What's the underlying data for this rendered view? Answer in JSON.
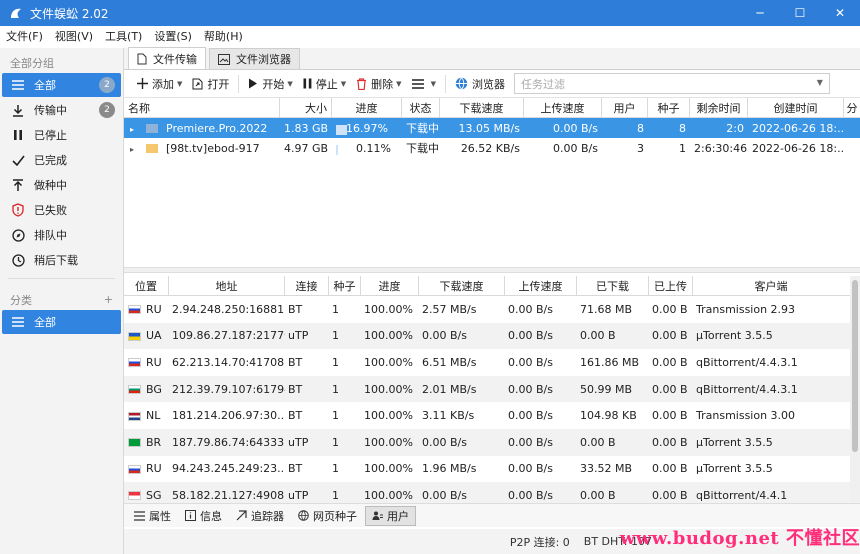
{
  "window": {
    "title": "文件蜈蚣 2.02",
    "minimize": "─",
    "maximize": "☐",
    "close": "✕"
  },
  "menu": [
    "文件(F)",
    "视图(V)",
    "工具(T)",
    "设置(S)",
    "帮助(H)"
  ],
  "sidebar": {
    "all_groups_label": "全部分组",
    "items": [
      {
        "label": "全部",
        "badge": "2",
        "icon": "list-icon"
      },
      {
        "label": "传输中",
        "badge": "2",
        "icon": "download-icon"
      },
      {
        "label": "已停止",
        "icon": "pause-icon"
      },
      {
        "label": "已完成",
        "icon": "check-icon"
      },
      {
        "label": "做种中",
        "icon": "seed-icon"
      },
      {
        "label": "已失败",
        "icon": "error-icon"
      },
      {
        "label": "排队中",
        "icon": "compass-icon"
      },
      {
        "label": "稍后下载",
        "icon": "clock-icon"
      }
    ],
    "category_label": "分类",
    "category_add": "+",
    "category_items": [
      {
        "label": "全部"
      }
    ]
  },
  "tabs": [
    {
      "label": "文件传输"
    },
    {
      "label": "文件浏览器"
    }
  ],
  "toolbar": {
    "add": "添加",
    "open": "打开",
    "start": "开始",
    "stop": "停止",
    "delete": "删除",
    "browser": "浏览器",
    "filter_placeholder": "任务过滤"
  },
  "tasks": {
    "columns": [
      "名称",
      "大小",
      "进度",
      "状态",
      "下载速度",
      "上传速度",
      "用户",
      "种子",
      "剩余时间",
      "创建时间",
      "分"
    ],
    "rows": [
      {
        "name": "Premiere.Pro.2022",
        "size": "1.83 GB",
        "progress": "16.97%",
        "progress_value": 0.1697,
        "status": "下载中",
        "down": "13.05 MB/s",
        "up": "0.00 B/s",
        "users": "8",
        "seeds": "8",
        "eta": "2:0",
        "created": "2022-06-26 18:...",
        "selected": true
      },
      {
        "name": "[98t.tv]ebod-917",
        "size": "4.97 GB",
        "progress": "0.11%",
        "progress_value": 0.0011,
        "status": "下载中",
        "down": "26.52 KB/s",
        "up": "0.00 B/s",
        "users": "3",
        "seeds": "1",
        "eta": "2:6:30:46",
        "created": "2022-06-26 18:...",
        "selected": false
      }
    ]
  },
  "peers": {
    "columns": [
      "位置",
      "地址",
      "连接",
      "种子",
      "进度",
      "下载速度",
      "上传速度",
      "已下载",
      "已上传",
      "客户端"
    ],
    "rows": [
      {
        "cc": "RU",
        "addr": "2.94.248.250:16881",
        "conn": "BT",
        "seed": "1",
        "prog": "100.00%",
        "down": "2.57 MB/s",
        "up": "0.00 B/s",
        "dl": "71.68 MB",
        "ul": "0.00 B",
        "client": "Transmission 2.93"
      },
      {
        "cc": "UA",
        "addr": "109.86.27.187:21770",
        "conn": "uTP",
        "seed": "1",
        "prog": "100.00%",
        "down": "0.00 B/s",
        "up": "0.00 B/s",
        "dl": "0.00 B",
        "ul": "0.00 B",
        "client": "µTorrent 3.5.5"
      },
      {
        "cc": "RU",
        "addr": "62.213.14.70:41708",
        "conn": "BT",
        "seed": "1",
        "prog": "100.00%",
        "down": "6.51 MB/s",
        "up": "0.00 B/s",
        "dl": "161.86 MB",
        "ul": "0.00 B",
        "client": "qBittorrent/4.4.3.1"
      },
      {
        "cc": "BG",
        "addr": "212.39.79.107:61794",
        "conn": "BT",
        "seed": "1",
        "prog": "100.00%",
        "down": "2.01 MB/s",
        "up": "0.00 B/s",
        "dl": "50.99 MB",
        "ul": "0.00 B",
        "client": "qBittorrent/4.4.3.1"
      },
      {
        "cc": "NL",
        "addr": "181.214.206.97:30...",
        "conn": "BT",
        "seed": "1",
        "prog": "100.00%",
        "down": "3.11 KB/s",
        "up": "0.00 B/s",
        "dl": "104.98 KB",
        "ul": "0.00 B",
        "client": "Transmission 3.00"
      },
      {
        "cc": "BR",
        "addr": "187.79.86.74:64333",
        "conn": "uTP",
        "seed": "1",
        "prog": "100.00%",
        "down": "0.00 B/s",
        "up": "0.00 B/s",
        "dl": "0.00 B",
        "ul": "0.00 B",
        "client": "µTorrent 3.5.5"
      },
      {
        "cc": "RU",
        "addr": "94.243.245.249:23...",
        "conn": "BT",
        "seed": "1",
        "prog": "100.00%",
        "down": "1.96 MB/s",
        "up": "0.00 B/s",
        "dl": "33.52 MB",
        "ul": "0.00 B",
        "client": "µTorrent 3.5.5"
      },
      {
        "cc": "SG",
        "addr": "58.182.21.127:49081",
        "conn": "uTP",
        "seed": "1",
        "prog": "100.00%",
        "down": "0.00 B/s",
        "up": "0.00 B/s",
        "dl": "0.00 B",
        "ul": "0.00 B",
        "client": "qBittorrent/4.4.1"
      }
    ]
  },
  "bottom_tabs": [
    {
      "label": "属性"
    },
    {
      "label": "信息"
    },
    {
      "label": "追踪器"
    },
    {
      "label": "网页种子"
    },
    {
      "label": "用户",
      "active": true
    }
  ],
  "status": {
    "p2p": "P2P 连接:  0",
    "bt_dht": "BT DHT:  107"
  },
  "watermark": "www.budog.net 不懂社区",
  "colors": {
    "titlebar": "#2e7dd8",
    "selection": "#3a95e4",
    "sidebar_active": "#3185e0"
  }
}
